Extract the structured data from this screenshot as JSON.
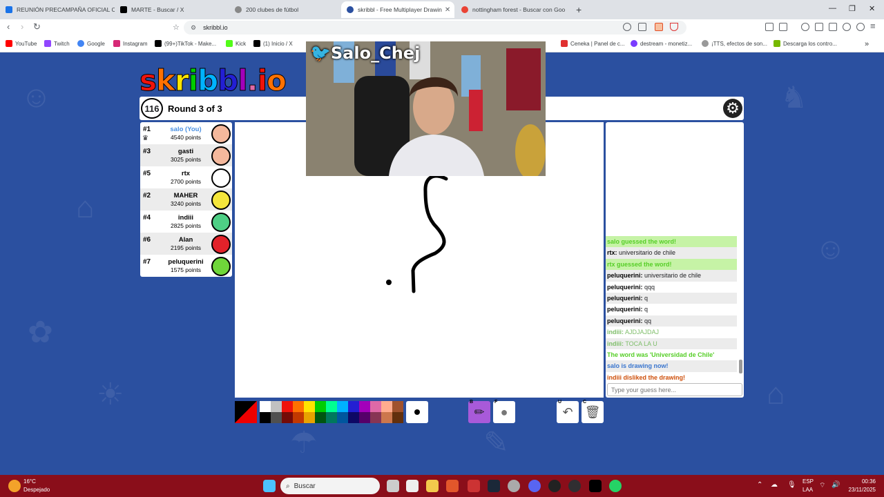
{
  "overlay": {
    "streamer_name": "Salo_Chej"
  },
  "browser": {
    "tabs": [
      {
        "title": "REUNIÓN PRECAMPAÑA OFICIAL CA",
        "active": false
      },
      {
        "title": "MARTE - Buscar / X",
        "active": false
      },
      {
        "title": "200 clubes de fútbol",
        "active": false
      },
      {
        "title": "skribbl - Free Multiplayer Drawin",
        "active": true
      },
      {
        "title": "nottingham forest - Buscar con Goo",
        "active": false
      }
    ],
    "new_tab": "+",
    "url": "skribbl.io",
    "bookmarks": [
      "YouTube",
      "Twitch",
      "Google",
      "Instagram",
      "(99+)TikTok - Make...",
      "Kick",
      "(1) Inicio / X",
      "Ceneka | Panel de c...",
      "destream - monetiz...",
      "¡TTS, efectos de son...",
      "Descarga los contro..."
    ]
  },
  "game": {
    "logo": "skribbl.io",
    "timer": "116",
    "round": "Round 3 of 3",
    "players": [
      {
        "rank": "#1",
        "name": "salo (You)",
        "points": "4540 points",
        "you": true,
        "color": "#f4b89c"
      },
      {
        "rank": "#3",
        "name": "gasti",
        "points": "3025 points",
        "you": false,
        "color": "#f4b89c"
      },
      {
        "rank": "#5",
        "name": "rtx",
        "points": "2700 points",
        "you": false,
        "color": "#ffffff"
      },
      {
        "rank": "#2",
        "name": "MAHER",
        "points": "3240 points",
        "you": false,
        "color": "#f5e63b"
      },
      {
        "rank": "#4",
        "name": "indiii",
        "points": "2825 points",
        "you": false,
        "color": "#4ecf85"
      },
      {
        "rank": "#6",
        "name": "Alan",
        "points": "2195 points",
        "you": false,
        "color": "#e2222a"
      },
      {
        "rank": "#7",
        "name": "peluquerini",
        "points": "1575 points",
        "you": false,
        "color": "#6fd63a"
      }
    ],
    "chat": [
      {
        "type": "g",
        "text": "salo guessed the word!"
      },
      {
        "type": "n",
        "user": "rtx:",
        "text": " universitario de chile"
      },
      {
        "type": "g",
        "text": "rtx guessed the word!"
      },
      {
        "type": "n",
        "user": "peluquerini:",
        "text": " universitario de chile"
      },
      {
        "type": "n",
        "user": "peluquerini:",
        "text": " qqq"
      },
      {
        "type": "n",
        "user": "peluquerini:",
        "text": " q"
      },
      {
        "type": "n",
        "user": "peluquerini:",
        "text": " q"
      },
      {
        "type": "n",
        "user": "peluquerini:",
        "text": " qq"
      },
      {
        "type": "i",
        "user": "indiii:",
        "text": " AJDJAJDAJ"
      },
      {
        "type": "i",
        "user": "indiii:",
        "text": " TOCA LA U"
      },
      {
        "type": "w",
        "text": "The word was 'Universidad de Chile'"
      },
      {
        "type": "d",
        "text": "salo is drawing now!"
      },
      {
        "type": "r",
        "text": "indiii disliked the drawing!"
      }
    ],
    "guess_placeholder": "Type your guess here...",
    "palette": [
      "#ffffff",
      "#c1c1c1",
      "#ef130b",
      "#ff7100",
      "#ffe400",
      "#00cc00",
      "#00ff91",
      "#00b2ff",
      "#231fd3",
      "#a300ba",
      "#df69a7",
      "#ffac8e",
      "#a0522d",
      "#000000",
      "#505050",
      "#740b07",
      "#c23800",
      "#e8a200",
      "#005510",
      "#00785d",
      "#00569e",
      "#0e0865",
      "#550069",
      "#873554",
      "#cc774d",
      "#63300d"
    ],
    "tool_keys": {
      "brush": "B",
      "fill": "F",
      "undo": "U",
      "clear": "C"
    }
  },
  "taskbar": {
    "weather_temp": "16°C",
    "weather_desc": "Despejado",
    "search": "Buscar",
    "lang": "ESP",
    "lang2": "LAA",
    "time": "00:36",
    "date": "23/11/2025"
  }
}
